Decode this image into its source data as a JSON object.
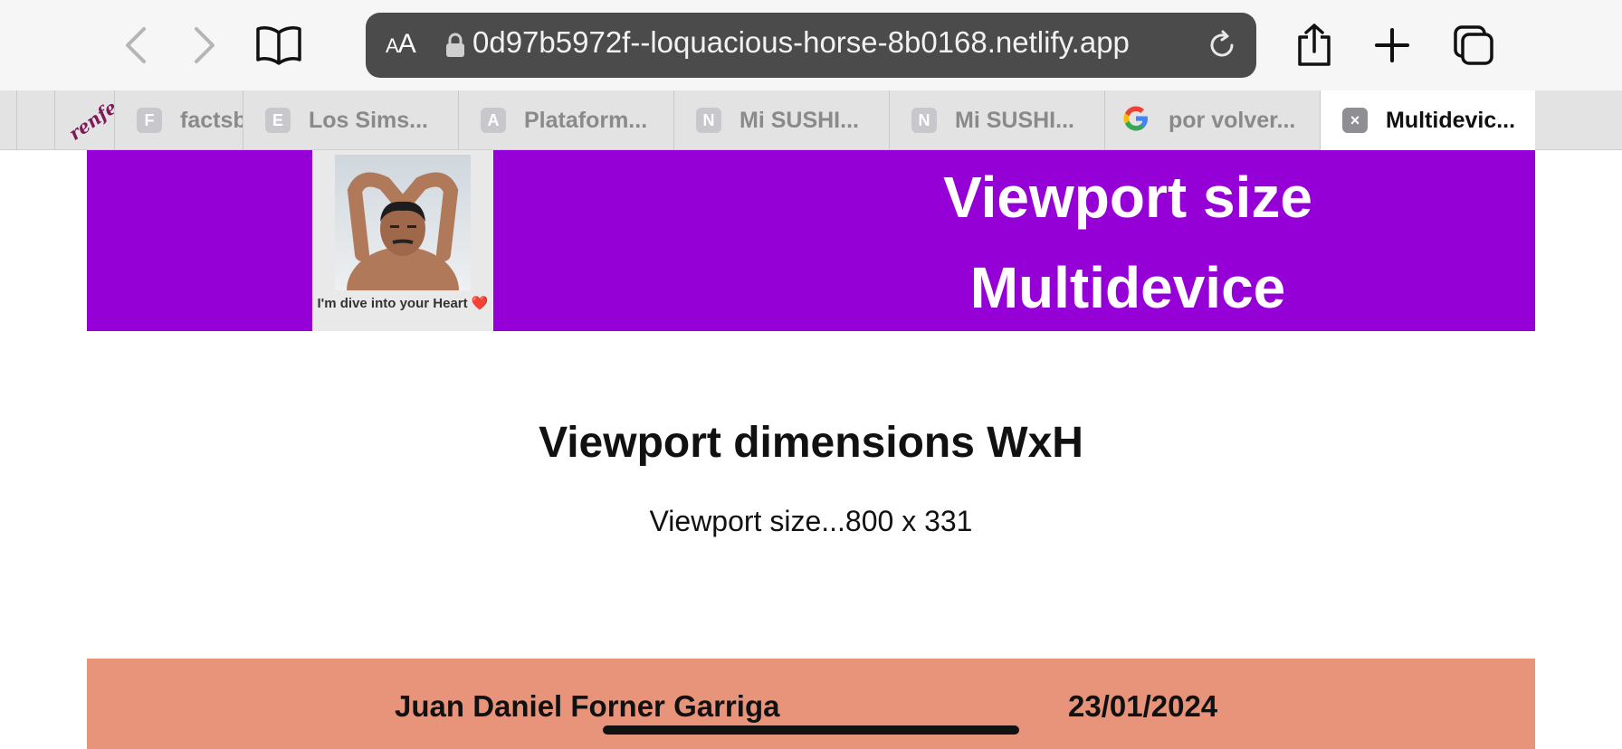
{
  "browser": {
    "aa_label_small": "A",
    "aa_label_large": "A",
    "url": "0d97b5972f--loquacious-horse-8b0168.netlify.app",
    "icons": {
      "back": "chevron-left-icon",
      "forward": "chevron-right-icon",
      "bookmarks": "book-icon",
      "lock": "lock-icon",
      "reload": "reload-icon",
      "share": "share-icon",
      "new_tab": "plus-icon",
      "tabs": "tabs-overview-icon"
    }
  },
  "tabs": [
    {
      "favicon": "renfe",
      "label": ""
    },
    {
      "favicon": "F",
      "label": "factsb"
    },
    {
      "favicon": "E",
      "label": "Los Sims..."
    },
    {
      "favicon": "A",
      "label": "Plataform..."
    },
    {
      "favicon": "N",
      "label": "Mi SUSHI..."
    },
    {
      "favicon": "N",
      "label": "Mi SUSHI..."
    },
    {
      "favicon": "G",
      "label": "por volver..."
    },
    {
      "favicon": "×",
      "label": "Multidevic..."
    }
  ],
  "header": {
    "caption": "I'm dive into your Heart ❤️",
    "title_line1": "Viewport size",
    "title_line2": "Multidevice",
    "bg_color": "#9500d6"
  },
  "main": {
    "heading": "Viewport dimensions WxH",
    "viewport_text": "Viewport size...800 x 331"
  },
  "footer": {
    "author": "Juan Daniel Forner Garriga",
    "date": "23/01/2024",
    "bg_color": "#e8947a"
  }
}
